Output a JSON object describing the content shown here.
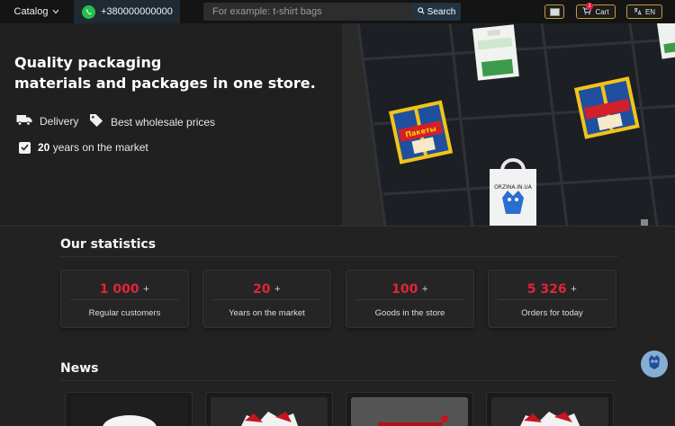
{
  "header": {
    "catalog_label": "Catalog",
    "phone": "+380000000000",
    "search_placeholder": "For example: t-shirt bags",
    "search_button": "Search",
    "cart_label": "Cart",
    "cart_count": "1",
    "language": "EN"
  },
  "hero": {
    "title_line1": "Quality packaging",
    "title_line2": "materials and packages in one store.",
    "features": {
      "delivery": "Delivery",
      "prices": "Best wholesale prices",
      "years_number": "20",
      "years_text": " years on the market"
    },
    "image_texts": {
      "package_label": "Пакеты",
      "bag_label": "ORZINA.IN.UA"
    }
  },
  "statistics": {
    "title": "Our statistics",
    "items": [
      {
        "value": "1 000",
        "suffix": "+",
        "label": "Regular customers"
      },
      {
        "value": "20",
        "suffix": "+",
        "label": "Years on the market"
      },
      {
        "value": "100",
        "suffix": "+",
        "label": "Goods in the store"
      },
      {
        "value": "5 326",
        "suffix": "+",
        "label": "Orders for today"
      }
    ]
  },
  "news": {
    "title": "News"
  },
  "colors": {
    "accent_red": "#e1243c",
    "header_bg": "#141414",
    "gold_border": "#c89a3a",
    "whatsapp_green": "#25c04a"
  },
  "icons": [
    "chevron-down-icon",
    "whatsapp-icon",
    "search-icon",
    "image-icon",
    "cart-icon",
    "translate-icon",
    "truck-icon",
    "tag-icon",
    "check-icon",
    "mascot-icon"
  ]
}
